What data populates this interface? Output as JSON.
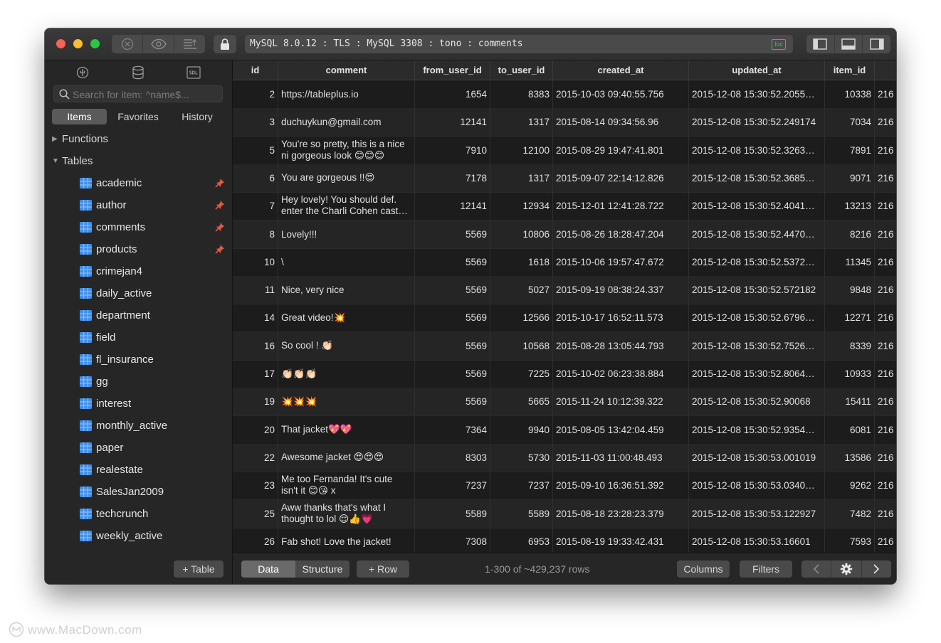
{
  "titlebar": {
    "connection": "MySQL 8.0.12 : TLS : MySQL 3308 : tono : comments",
    "badge": "loc"
  },
  "sidebar": {
    "search_placeholder": "Search for item: ^name$...",
    "filters": [
      "Items",
      "Favorites",
      "History"
    ],
    "groups": {
      "functions": "Functions",
      "tables": "Tables"
    },
    "tables": [
      {
        "name": "academic",
        "pinned": true
      },
      {
        "name": "author",
        "pinned": true
      },
      {
        "name": "comments",
        "pinned": true
      },
      {
        "name": "products",
        "pinned": true
      },
      {
        "name": "crimejan4",
        "pinned": false
      },
      {
        "name": "daily_active",
        "pinned": false
      },
      {
        "name": "department",
        "pinned": false
      },
      {
        "name": "field",
        "pinned": false
      },
      {
        "name": "fl_insurance",
        "pinned": false
      },
      {
        "name": "gg",
        "pinned": false
      },
      {
        "name": "interest",
        "pinned": false
      },
      {
        "name": "monthly_active",
        "pinned": false
      },
      {
        "name": "paper",
        "pinned": false
      },
      {
        "name": "realestate",
        "pinned": false
      },
      {
        "name": "SalesJan2009",
        "pinned": false
      },
      {
        "name": "techcrunch",
        "pinned": false
      },
      {
        "name": "weekly_active",
        "pinned": false
      }
    ],
    "add_table": "+ Table"
  },
  "grid": {
    "columns": [
      "id",
      "comment",
      "from_user_id",
      "to_user_id",
      "created_at",
      "updated_at",
      "item_id"
    ],
    "rows": [
      [
        "2",
        "https://tableplus.io",
        "1654",
        "8383",
        "2015-10-03 09:40:55.756",
        "2015-12-08 15:30:52.2055…",
        "10338",
        "216"
      ],
      [
        "3",
        "duchuykun@gmail.com",
        "12141",
        "1317",
        "2015-08-14 09:34:56.96",
        "2015-12-08 15:30:52.249174",
        "7034",
        "216"
      ],
      [
        "5",
        "You're so pretty, this is a nice ni gorgeous look 😊😊😊",
        "7910",
        "12100",
        "2015-08-29 19:47:41.801",
        "2015-12-08 15:30:52.3263…",
        "7891",
        "216"
      ],
      [
        "6",
        "You are gorgeous !!😍",
        "7178",
        "1317",
        "2015-09-07 22:14:12.826",
        "2015-12-08 15:30:52.3685…",
        "9071",
        "216"
      ],
      [
        "7",
        "Hey lovely! You should def. enter the Charli Cohen cast…",
        "12141",
        "12934",
        "2015-12-01 12:41:28.722",
        "2015-12-08 15:30:52.4041…",
        "13213",
        "216"
      ],
      [
        "8",
        "Lovely!!!",
        "5569",
        "10806",
        "2015-08-26 18:28:47.204",
        "2015-12-08 15:30:52.4470…",
        "8216",
        "216"
      ],
      [
        "10",
        "\\",
        "5569",
        "1618",
        "2015-10-06 19:57:47.672",
        "2015-12-08 15:30:52.5372…",
        "11345",
        "216"
      ],
      [
        "11",
        "Nice, very nice",
        "5569",
        "5027",
        "2015-09-19 08:38:24.337",
        "2015-12-08 15:30:52.572182",
        "9848",
        "216"
      ],
      [
        "14",
        "Great video!💥",
        "5569",
        "12566",
        "2015-10-17 16:52:11.573",
        "2015-12-08 15:30:52.6796…",
        "12271",
        "216"
      ],
      [
        "16",
        "So cool ! 👏🏻",
        "5569",
        "10568",
        "2015-08-28 13:05:44.793",
        "2015-12-08 15:30:52.7526…",
        "8339",
        "216"
      ],
      [
        "17",
        "👏🏻👏🏻👏🏻",
        "5569",
        "7225",
        "2015-10-02 06:23:38.884",
        "2015-12-08 15:30:52.8064…",
        "10933",
        "216"
      ],
      [
        "19",
        "💥💥💥",
        "5569",
        "5665",
        "2015-11-24 10:12:39.322",
        "2015-12-08 15:30:52.90068",
        "15411",
        "216"
      ],
      [
        "20",
        "That jacket💖💖",
        "7364",
        "9940",
        "2015-08-05 13:42:04.459",
        "2015-12-08 15:30:52.9354…",
        "6081",
        "216"
      ],
      [
        "22",
        "Awesome jacket 😍😍😍",
        "8303",
        "5730",
        "2015-11-03 11:00:48.493",
        "2015-12-08 15:30:53.001019",
        "13586",
        "216"
      ],
      [
        "23",
        "Me too Fernanda! It's cute isn't it 😊😘 x",
        "7237",
        "7237",
        "2015-09-10 16:36:51.392",
        "2015-12-08 15:30:53.0340…",
        "9262",
        "216"
      ],
      [
        "25",
        "Aww thanks that's what I thought to lol 😌👍💗",
        "5589",
        "5589",
        "2015-08-18 23:28:23.379",
        "2015-12-08 15:30:53.122927",
        "7482",
        "216"
      ],
      [
        "26",
        "Fab shot! Love the jacket!",
        "7308",
        "6953",
        "2015-08-19 19:33:42.431",
        "2015-12-08 15:30:53.16601",
        "7593",
        "216"
      ]
    ]
  },
  "bottombar": {
    "tabs": [
      "Data",
      "Structure"
    ],
    "add_row": "+ Row",
    "row_count": "1-300 of ~429,237 rows",
    "columns_btn": "Columns",
    "filters_btn": "Filters"
  },
  "watermark": "www.MacDown.com",
  "colors": {
    "accent_close": "#fe5f57",
    "accent_min": "#febc2e",
    "accent_max": "#28c840",
    "loc_badge": "#2ec44a",
    "table_icon": "#3f8ee8",
    "pin": "#e3573f"
  }
}
